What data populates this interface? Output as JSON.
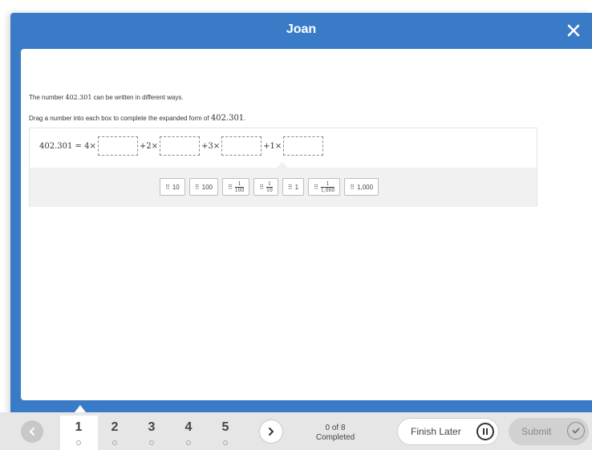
{
  "window": {
    "title": "Joan"
  },
  "question": {
    "intro_prefix": "The number ",
    "intro_number": "402.301",
    "intro_suffix": " can be written in different ways.",
    "instruction_prefix": "Drag a number into each box to complete the expanded form of ",
    "instruction_number": "402.301",
    "instruction_suffix": ".",
    "equation": {
      "lhs": "402.301 = 4×",
      "op2": "+2×",
      "op3": "+3×",
      "op4": "+1×"
    },
    "tiles": [
      {
        "label": "10"
      },
      {
        "label": "100"
      },
      {
        "numerator": "1",
        "denominator": "100"
      },
      {
        "numerator": "1",
        "denominator": "10"
      },
      {
        "label": "1"
      },
      {
        "numerator": "1",
        "denominator": "1,000"
      },
      {
        "label": "1,000"
      }
    ]
  },
  "footer": {
    "questions": [
      "1",
      "2",
      "3",
      "4",
      "5"
    ],
    "current": "1",
    "progress_count": "0 of 8",
    "progress_label": "Completed",
    "finish_later_label": "Finish Later",
    "submit_label": "Submit"
  },
  "colors": {
    "header": "#3a7bc8",
    "footer": "#e6e6e6",
    "tray": "#f1f1f1"
  },
  "icons": [
    "close-icon",
    "chevron-left-icon",
    "chevron-right-icon",
    "pause-icon",
    "check-icon",
    "grip-icon"
  ]
}
